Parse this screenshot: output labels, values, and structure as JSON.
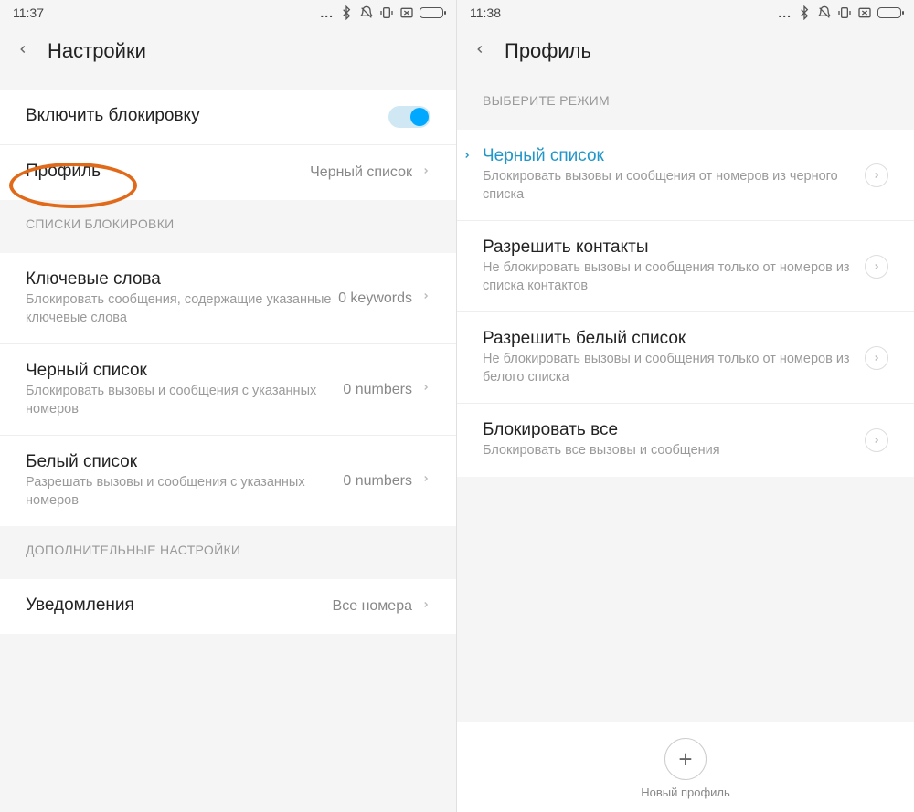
{
  "left": {
    "statusbar": {
      "time": "11:37",
      "dots": "..."
    },
    "header": {
      "title": "Настройки"
    },
    "toggle_row": {
      "label": "Включить блокировку",
      "on": true
    },
    "profile_row": {
      "label": "Профиль",
      "value": "Черный список"
    },
    "section_blocklists": {
      "label": "СПИСКИ БЛОКИРОВКИ"
    },
    "keywords": {
      "title": "Ключевые слова",
      "sub": "Блокировать сообщения, содержащие указанные ключевые слова",
      "value": "0 keywords"
    },
    "blacklist": {
      "title": "Черный список",
      "sub": "Блокировать вызовы и сообщения с указанных номеров",
      "value": "0 numbers"
    },
    "whitelist": {
      "title": "Белый список",
      "sub": "Разрешать вызовы и сообщения с указанных номеров",
      "value": "0 numbers"
    },
    "section_additional": {
      "label": "ДОПОЛНИТЕЛЬНЫЕ НАСТРОЙКИ"
    },
    "notifications": {
      "title": "Уведомления",
      "value": "Все номера"
    }
  },
  "right": {
    "statusbar": {
      "time": "11:38",
      "dots": "..."
    },
    "header": {
      "title": "Профиль"
    },
    "section_mode": {
      "label": "ВЫБЕРИТЕ РЕЖИМ"
    },
    "opt_blacklist": {
      "title": "Черный список",
      "sub": "Блокировать вызовы и сообщения от номеров из черного списка",
      "selected": true
    },
    "opt_contacts": {
      "title": "Разрешить контакты",
      "sub": "Не блокировать вызовы и сообщения только от номеров из списка контактов"
    },
    "opt_whitelist": {
      "title": "Разрешить белый список",
      "sub": "Не блокировать вызовы и сообщения только от номеров из белого списка"
    },
    "opt_blockall": {
      "title": "Блокировать все",
      "sub": "Блокировать все вызовы и сообщения"
    },
    "footer": {
      "label": "Новый профиль"
    }
  }
}
